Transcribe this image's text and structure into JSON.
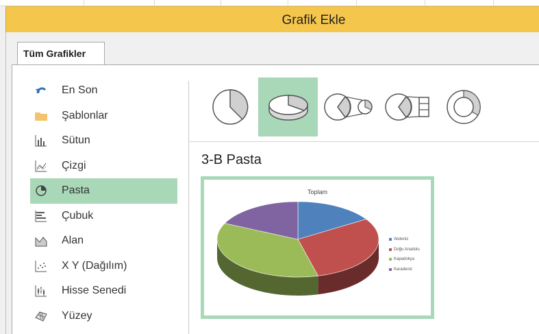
{
  "window": {
    "title": "Grafik Ekle"
  },
  "tabs": [
    {
      "label": "Tüm Grafikler",
      "active": true
    }
  ],
  "sidebar": {
    "items": [
      {
        "label": "En Son",
        "icon": "recent-icon"
      },
      {
        "label": "Şablonlar",
        "icon": "folder-icon"
      },
      {
        "label": "Sütun",
        "icon": "column-chart-icon"
      },
      {
        "label": "Çizgi",
        "icon": "line-chart-icon"
      },
      {
        "label": "Pasta",
        "icon": "pie-chart-icon",
        "active": true
      },
      {
        "label": "Çubuk",
        "icon": "bar-chart-icon"
      },
      {
        "label": "Alan",
        "icon": "area-chart-icon"
      },
      {
        "label": "X Y (Dağılım)",
        "icon": "scatter-chart-icon"
      },
      {
        "label": "Hisse Senedi",
        "icon": "stock-chart-icon"
      },
      {
        "label": "Yüzey",
        "icon": "surface-chart-icon"
      }
    ]
  },
  "subtypes": [
    {
      "icon": "pie-icon"
    },
    {
      "icon": "pie-3d-icon",
      "active": true
    },
    {
      "icon": "pie-of-pie-icon"
    },
    {
      "icon": "bar-of-pie-icon"
    },
    {
      "icon": "doughnut-icon"
    }
  ],
  "selected_subtype_title": "3-B Pasta",
  "preview": {
    "chart_data": {
      "type": "pie",
      "title": "Toplam",
      "categories": [
        "Akdeniz",
        "Doğu Anadolu",
        "Kapadokya",
        "Karadeniz"
      ],
      "values": [
        16,
        30,
        36,
        18
      ],
      "colors": [
        "#4f81bd",
        "#c0504d",
        "#9bbb59",
        "#8064a2"
      ],
      "legend_position": "right"
    }
  },
  "colors": {
    "title_bar": "#f5c64c",
    "selection": "#a9d8b8"
  }
}
